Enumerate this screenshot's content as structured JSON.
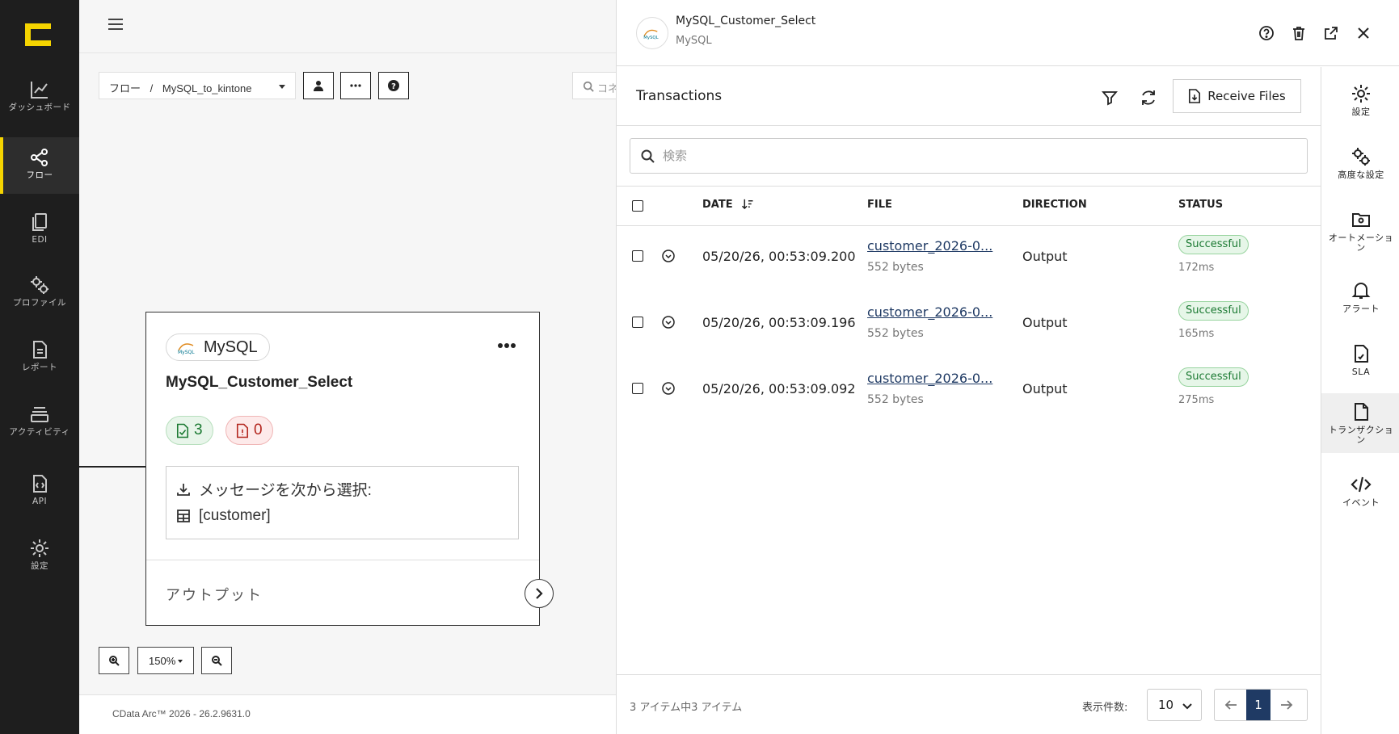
{
  "nav": {
    "items": [
      {
        "label": "ダッシュボード",
        "icon": "chart-icon"
      },
      {
        "label": "フロー",
        "icon": "flow-icon",
        "active": true
      },
      {
        "label": "EDI",
        "icon": "documents-icon"
      },
      {
        "label": "プロファイル",
        "icon": "gears-icon"
      },
      {
        "label": "レポート",
        "icon": "report-icon"
      },
      {
        "label": "アクティビティ",
        "icon": "activity-icon"
      },
      {
        "label": "API",
        "icon": "api-icon"
      },
      {
        "label": "設定",
        "icon": "settings-icon"
      }
    ]
  },
  "canvas": {
    "breadcrumb_root": "フロー",
    "breadcrumb_sep": "/",
    "flow_name": "MySQL_to_kintone",
    "search_placeholder": "コネ",
    "zoom_level": "150%",
    "version": "CData Arc™ 2026 - 26.2.9631.0"
  },
  "node": {
    "connector_type": "MySQL",
    "title": "MySQL_Customer_Select",
    "success_count": "3",
    "error_count": "0",
    "message_label": "メッセージを次から選択:",
    "table_name": "[customer]",
    "output_label": "アウトプット"
  },
  "panel": {
    "title": "MySQL_Customer_Select",
    "subtitle": "MySQL",
    "tx_title": "Transactions",
    "receive_label": "Receive Files",
    "search_placeholder": "検索",
    "columns": {
      "date": "DATE",
      "file": "FILE",
      "direction": "DIRECTION",
      "status": "STATUS"
    },
    "rows": [
      {
        "date": "05/20/26, 00:53:09.200",
        "file": "customer_2026-0...",
        "size": "552 bytes",
        "direction": "Output",
        "status": "Successful",
        "duration": "172ms"
      },
      {
        "date": "05/20/26, 00:53:09.196",
        "file": "customer_2026-0...",
        "size": "552 bytes",
        "direction": "Output",
        "status": "Successful",
        "duration": "165ms"
      },
      {
        "date": "05/20/26, 00:53:09.092",
        "file": "customer_2026-0...",
        "size": "552 bytes",
        "direction": "Output",
        "status": "Successful",
        "duration": "275ms"
      }
    ],
    "footer_count": "3 アイテム中3 アイテム",
    "page_size_label": "表示件数:",
    "page_size": "10",
    "current_page": "1"
  },
  "toolbar": {
    "items": [
      {
        "label": "設定"
      },
      {
        "label": "高度な設定"
      },
      {
        "label": "オートメーション"
      },
      {
        "label": "アラート"
      },
      {
        "label": "SLA"
      },
      {
        "label": "トランザクション",
        "active": true
      },
      {
        "label": "イベント"
      }
    ]
  },
  "colors": {
    "nav_bg": "#1e1e1e",
    "accent_yellow": "#f5d400",
    "page_active": "#1f3a64",
    "success_green": "#1c7a33",
    "error_red": "#b3261e"
  }
}
